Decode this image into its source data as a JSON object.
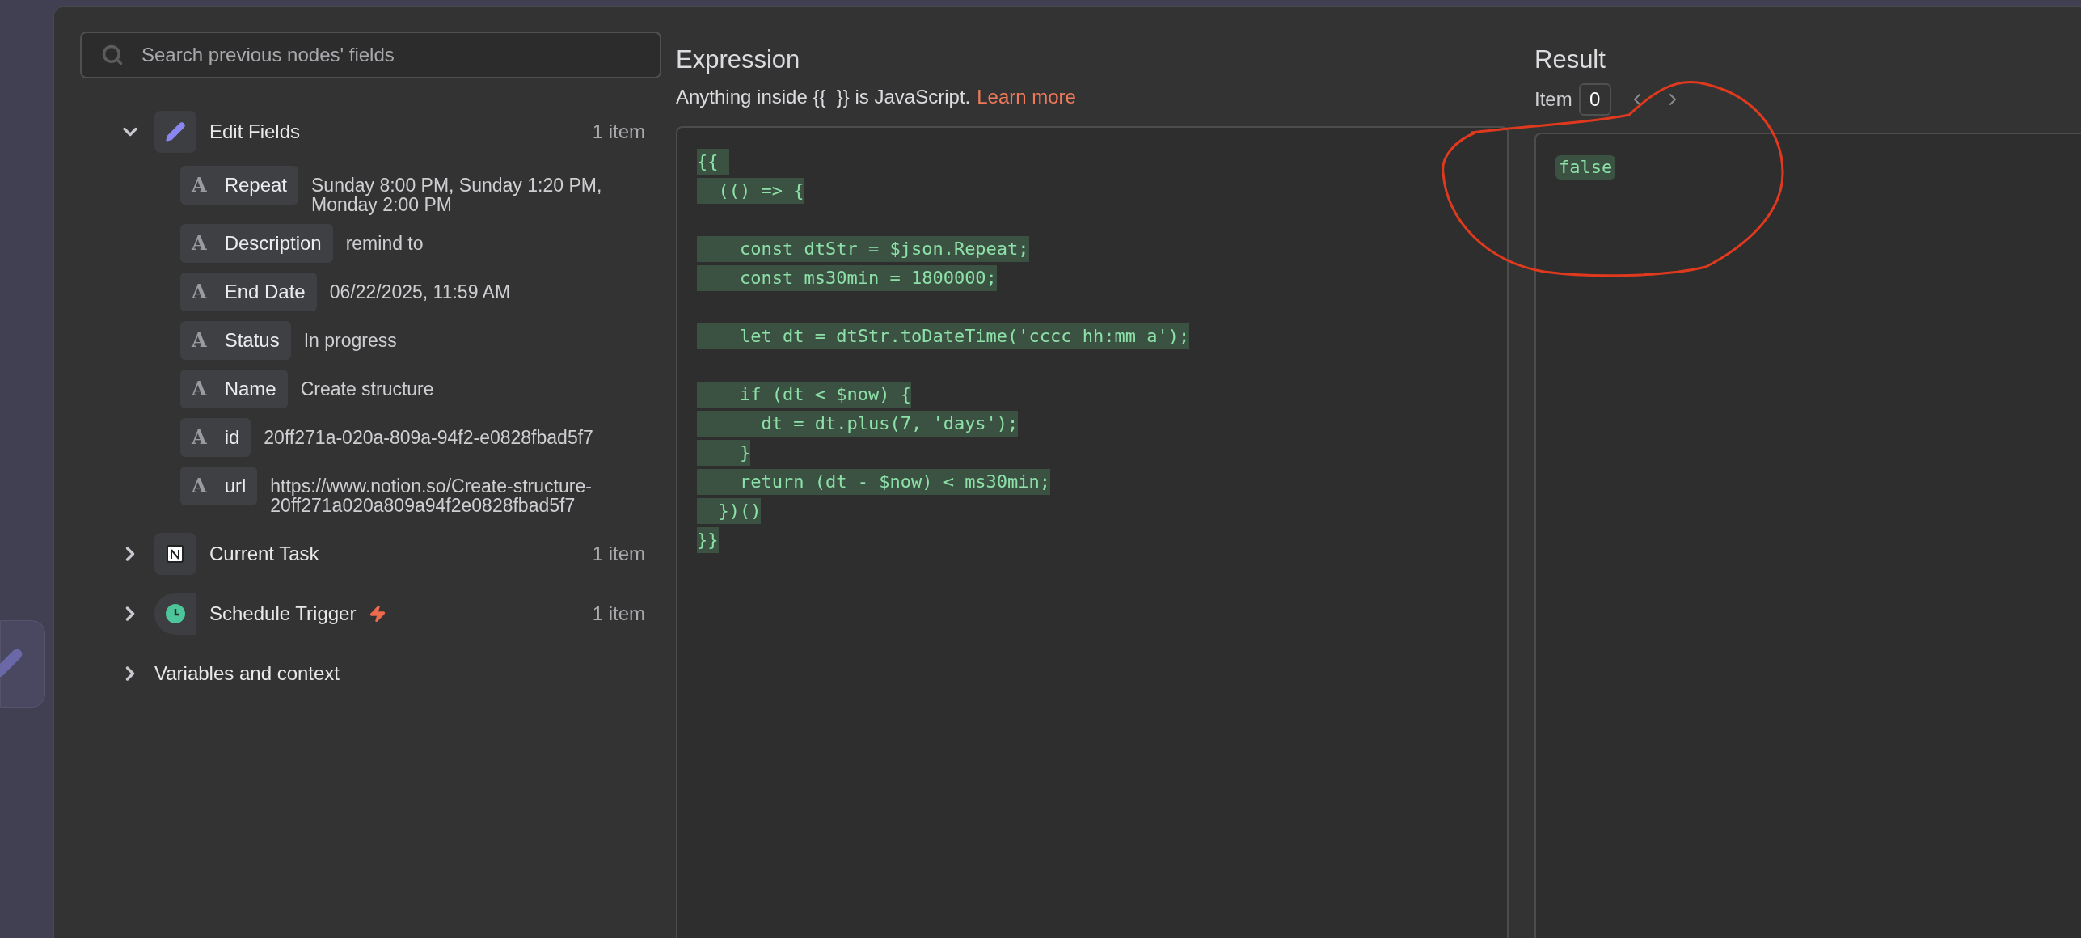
{
  "search": {
    "placeholder": "Search previous nodes' fields"
  },
  "nodes": [
    {
      "name": "Edit Fields",
      "kind": "pencil",
      "expanded": true,
      "trigger": false,
      "count": "1 item",
      "fields": [
        {
          "type_glyph": "A",
          "name": "Repeat",
          "value": "Sunday 8:00 PM, Sunday 1:20 PM, Monday 2:00 PM"
        },
        {
          "type_glyph": "A",
          "name": "Description",
          "value": "remind to"
        },
        {
          "type_glyph": "A",
          "name": "End Date",
          "value": "06/22/2025, 11:59 AM"
        },
        {
          "type_glyph": "A",
          "name": "Status",
          "value": "In progress"
        },
        {
          "type_glyph": "A",
          "name": "Name",
          "value": "Create structure"
        },
        {
          "type_glyph": "A",
          "name": "id",
          "value": "20ff271a-020a-809a-94f2-e0828fbad5f7"
        },
        {
          "type_glyph": "A",
          "name": "url",
          "value": "https://www.notion.so/Create-structure-20ff271a020a809a94f2e0828fbad5f7"
        }
      ]
    },
    {
      "name": "Current Task",
      "kind": "logo",
      "expanded": false,
      "trigger": false,
      "count": "1 item"
    },
    {
      "name": "Schedule Trigger",
      "kind": "clock",
      "expanded": false,
      "trigger": true,
      "count": "1 item"
    }
  ],
  "variables": {
    "label": "Variables and context",
    "expanded": false
  },
  "expression": {
    "title": "Expression",
    "hint": "Anything inside {{  }} is JavaScript.",
    "link": "Learn more",
    "code": "{{ \n  (() => {\n\n    const dtStr = $json.Repeat;\n    const ms30min = 1800000;\n\n    let dt = dtStr.toDateTime('cccc hh:mm a');\n\n    if (dt < $now) {\n      dt = dt.plus(7, 'days');\n    }\n    return (dt - $now) < ms30min;\n  })()\n}}"
  },
  "result": {
    "title": "Result",
    "item_label": "Item",
    "item_index": "0",
    "value": "false"
  }
}
